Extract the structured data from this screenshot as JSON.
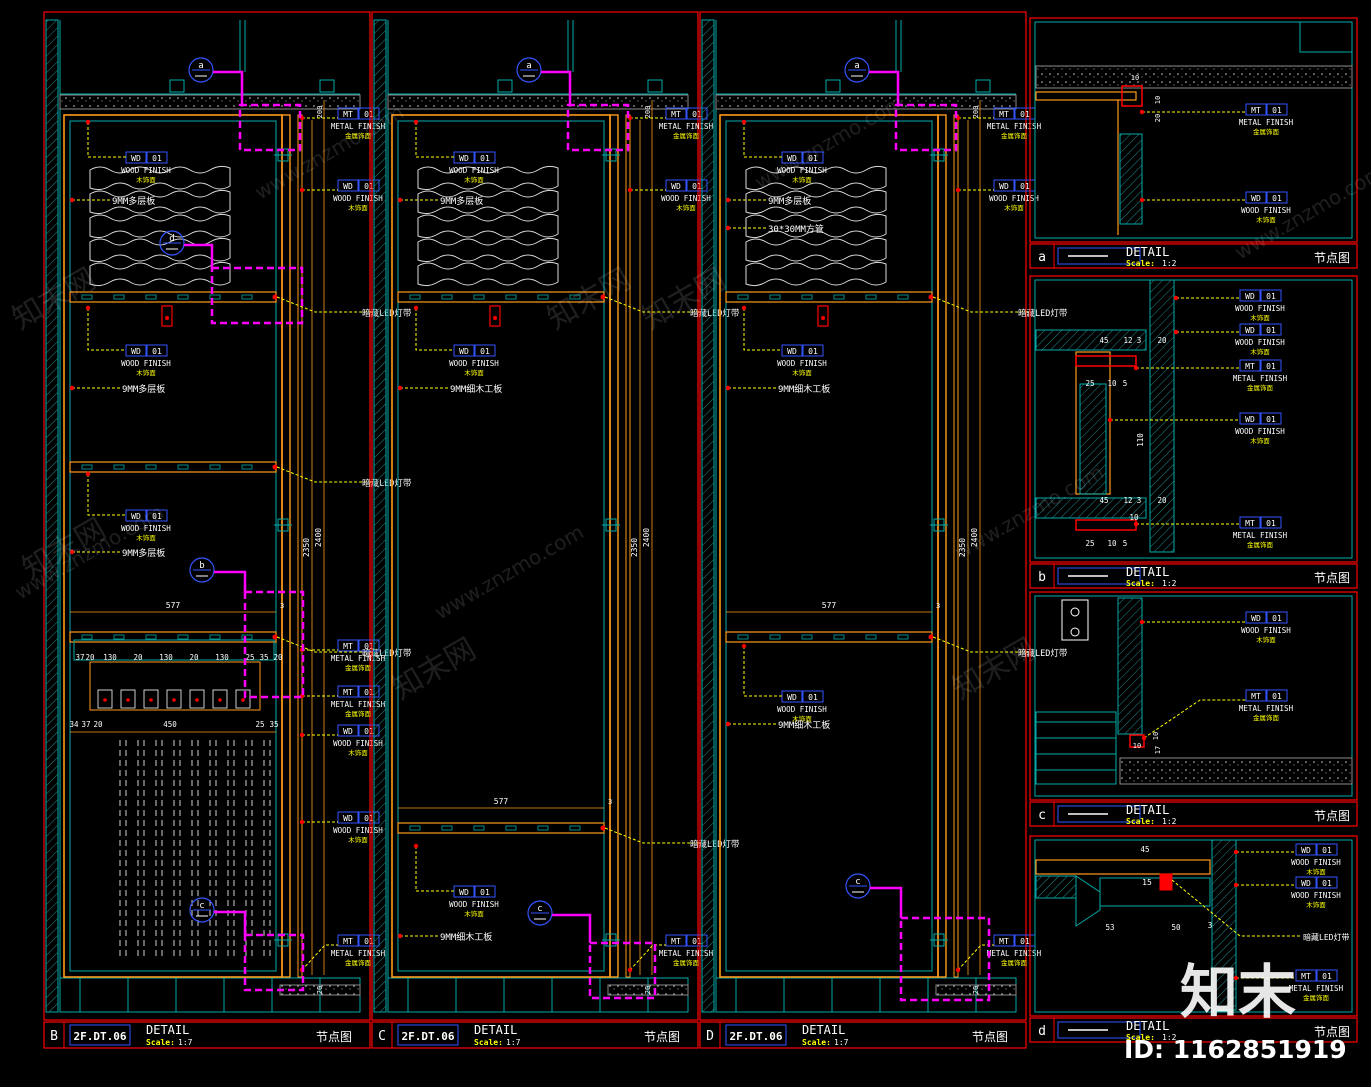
{
  "detail_title": "DETAIL",
  "title_cn": "节点图",
  "scale_label": "Scale:",
  "panels": [
    {
      "id": "B",
      "drawing_no": "2F.DT.06",
      "scale": "1:7"
    },
    {
      "id": "C",
      "drawing_no": "2F.DT.06",
      "scale": "1:7"
    },
    {
      "id": "D",
      "drawing_no": "2F.DT.06",
      "scale": "1:7"
    }
  ],
  "details": [
    {
      "id": "a",
      "scale": "1:2"
    },
    {
      "id": "b",
      "scale": "1:2"
    },
    {
      "id": "c",
      "scale": "1:2"
    },
    {
      "id": "d",
      "scale": "1:2"
    }
  ],
  "tags": {
    "wood": {
      "code": "WD",
      "num": "01",
      "name": "WOOD FINISH",
      "cn": "木饰面"
    },
    "metal": {
      "code": "MT",
      "num": "01",
      "name": "METAL FINISH",
      "cn": "金属饰面"
    }
  },
  "notes": {
    "board_9mm": "9MM多层板",
    "board_9mm_c": "9MM细木工板",
    "tube_30": "30*30MM方管",
    "led": "暗藏LED灯带"
  },
  "dims": {
    "d2350": "2350",
    "d2400": "2400",
    "d577": "577",
    "d3": "3",
    "d20": "20",
    "d200": "200",
    "drawer_top": [
      "37",
      "20",
      "130",
      "20",
      "130",
      "20",
      "130",
      "25",
      "35",
      "20"
    ],
    "drawer_bot": [
      "34",
      "37",
      "20",
      "450",
      "25",
      "35"
    ],
    "det_a": [
      "10",
      "10",
      "20"
    ],
    "det_b": [
      "45",
      "12",
      "3",
      "20",
      "25",
      "10",
      "5",
      "110",
      "45",
      "12",
      "3",
      "20",
      "25",
      "10",
      "5",
      "10"
    ],
    "det_c": [
      "10",
      "17",
      "10"
    ],
    "det_d": [
      "45",
      "15",
      "53",
      "50",
      "3"
    ]
  },
  "watermark": {
    "cn": "知末网",
    "url": "www.znzmo.com",
    "brand": "知末",
    "id": "ID: 1162851919"
  },
  "colors": {
    "frame": "#ff0000",
    "panel": "#ff2222",
    "cabinet": "#ff9a1a",
    "wall": "#00aaaa",
    "tag": "#ffff00",
    "magenta": "#ff00ff",
    "blue": "#3355ff",
    "white": "#ffffff"
  }
}
